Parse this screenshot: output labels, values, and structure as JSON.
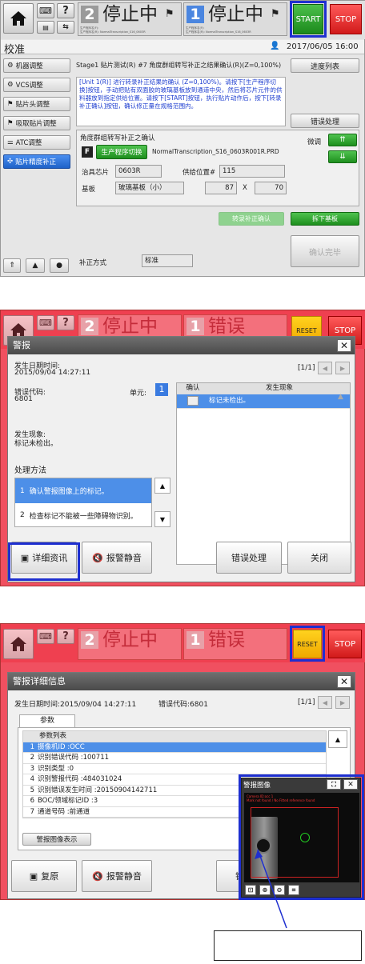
{
  "panel1": {
    "status_a_num": "2",
    "status_a_text": "停止中",
    "status_a_line1": "生产程序名(F):",
    "status_a_line2": "生产程序名(R): NormalTranscription_S16_0603R",
    "status_b_num": "1",
    "status_b_text": "停止中",
    "status_b_line1": "生产程序名(F):",
    "status_b_line2": "生产程序名(R): NormalTranscription_S16_0603R",
    "start_label": "START",
    "stop_label": "STOP",
    "screen_title": "校准",
    "datetime": "2017/06/05 16:00",
    "sidebar": [
      "机器调整",
      "VCS调整",
      "贴片头调整",
      "吸取贴片调整",
      "ATC调整",
      "贴片精度补正"
    ],
    "stage_title": "Stage1 贴片测试(R) #7 角度群组转写补正之结果确认(R)(Z=0,100%)",
    "progress_list": "进度列表",
    "instruction": "[Unit 1(R)] 进行转录补正结果的确认 (Z=0,100%)。请按下[生产程序切换]按钮，手动把贴有双面胶的玻璃基板放到通道中央，然后将芯片元件的供料器放到指定供给位置。请按下[START]按钮，执行贴片动作后，按下[转录补正确认]按钮，确认修正量在规格范围内。",
    "error_handling": "错误处理",
    "group_title": "角度群组转写补正之确认",
    "f_badge": "F",
    "program_switch": "生产程序切换",
    "program_name": "NormalTranscription_S16_0603R001R.PRD",
    "fine_tune": "微调",
    "chip_label": "治具芯片",
    "chip_value": "0603R",
    "supply_label": "供给位置#",
    "supply_value": "115",
    "board_label": "基板",
    "board_value": "玻璃基板（小）",
    "board_x": "87",
    "x_label": "X",
    "board_y": "70",
    "transcribe_confirm": "转录补正确认",
    "remove_board": "拆下基板",
    "confirm_done": "确认完毕",
    "correction_label": "补正方式",
    "correction_value": "标准"
  },
  "panel2": {
    "status_a_num": "2",
    "status_a_text": "停止中",
    "status_b_num": "1",
    "status_b_text": "错误",
    "reset_label": "RESET",
    "stop_label": "STOP",
    "dialog_title": "警报",
    "occur_label": "发生日期时间:",
    "occur_value": "2015/09/04 14:27:11",
    "page": "[1/1]",
    "code_label": "错误代码:",
    "code_value": "6801",
    "unit_label": "单元:",
    "unit_value": "1",
    "col_confirm": "确认",
    "col_phenomenon": "发生现象",
    "table_row": "标记未检出。",
    "phenomenon_label": "发生现象:",
    "phenomenon_value": "标记未检出。",
    "method_label": "处理方法",
    "methods": [
      "确认警报图像上的标记。",
      "检查标记不能被一些障碍物识别。"
    ],
    "method_nums": [
      "1",
      "2"
    ],
    "btn_detail": "详细资讯",
    "btn_mute": "报警静音",
    "btn_error": "错误处理",
    "btn_close": "关闭"
  },
  "panel3": {
    "status_a_num": "2",
    "status_a_text": "停止中",
    "status_b_num": "1",
    "status_b_text": "错误",
    "reset_label": "RESET",
    "stop_label": "STOP",
    "dialog_title": "警报详细信息",
    "occur": "发生日期时间:2015/09/04 14:27:11",
    "code": "错误代码:6801",
    "page": "[1/1]",
    "tab": "参数",
    "list_header": "参数列表",
    "params": [
      "摄像机ID :OCC",
      "识别错误代码 :100711",
      "识别类型 :0",
      "识别警报代码 :484031024",
      "识别错误发生时间 :20150904142711",
      "BOC/领域标记ID :3",
      "通道号码 :前通道"
    ],
    "param_nums": [
      "1",
      "2",
      "3",
      "4",
      "5",
      "6",
      "7"
    ],
    "alarm_image_btn": "警报图像表示",
    "btn_restore": "复原",
    "btn_mute": "报警静音",
    "btn_partial": "错",
    "popup_title": "警报图像",
    "popup_text1": "Camera ID:occ 1",
    "popup_text2": "Mark not found / No Fitted reference found"
  }
}
